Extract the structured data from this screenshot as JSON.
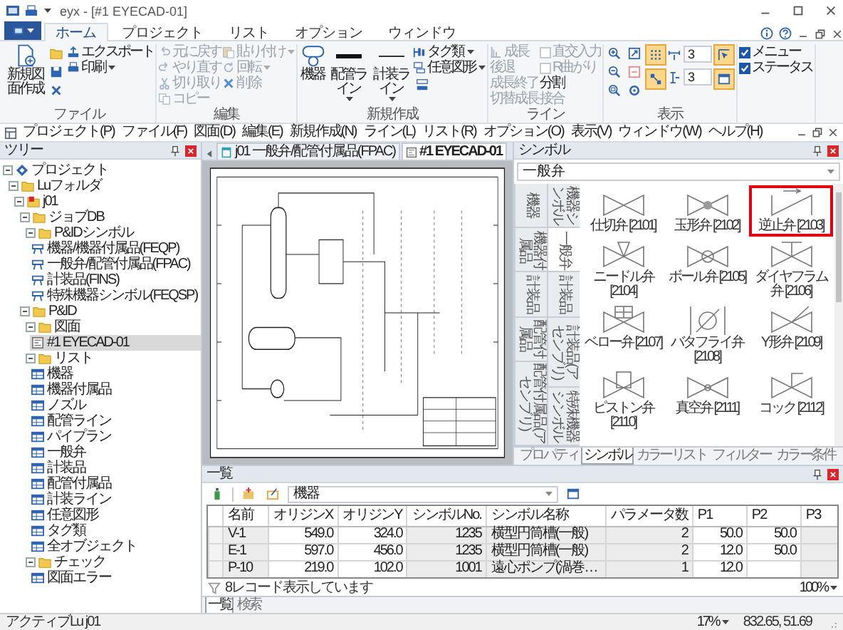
{
  "window": {
    "title": "eyx - [#1 EYECAD-01]"
  },
  "ribbon": {
    "tabs": [
      {
        "label": "ホーム",
        "selected": true
      },
      {
        "label": "プロジェクト",
        "selected": false
      },
      {
        "label": "リスト",
        "selected": false
      },
      {
        "label": "オプション",
        "selected": false
      },
      {
        "label": "ウィンドウ",
        "selected": false
      }
    ],
    "groups": [
      {
        "label": "ファイル",
        "columns": [
          [
            {
              "kind": "large",
              "label": "新規図面作成"
            }
          ],
          [
            {
              "kind": "icon"
            },
            {
              "kind": "icon"
            },
            {
              "kind": "icon"
            }
          ],
          [
            {
              "kind": "small",
              "label": "エクスポート"
            },
            {
              "kind": "small",
              "label": "印刷",
              "dropdown": true
            }
          ]
        ]
      },
      {
        "label": "編集",
        "columns": [
          [
            {
              "kind": "small",
              "label": "元に戻す",
              "disabled": true
            },
            {
              "kind": "small",
              "label": "やり直す",
              "disabled": true
            },
            {
              "kind": "small",
              "label": "切り取り",
              "disabled": true
            },
            {
              "kind": "small",
              "label": "コピー",
              "disabled": true
            }
          ],
          [
            {
              "kind": "small",
              "label": "貼り付け",
              "disabled": true,
              "dropdown": true
            },
            {
              "kind": "small",
              "label": "回転",
              "disabled": true,
              "dropdown": true
            },
            {
              "kind": "small",
              "label": "削除",
              "disabled": true
            }
          ]
        ]
      },
      {
        "label": "新規作成",
        "columns": [
          [
            {
              "kind": "large",
              "label": "機器"
            }
          ],
          [
            {
              "kind": "large",
              "label": "配管ライン",
              "dropdown": true
            }
          ],
          [
            {
              "kind": "large",
              "label": "計装ライン",
              "dropdown": true
            }
          ],
          [
            {
              "kind": "small",
              "label": "タグ類",
              "dropdown": true
            },
            {
              "kind": "small",
              "label": "任意図形",
              "dropdown": true
            },
            {
              "kind": "icon"
            }
          ]
        ]
      },
      {
        "label": "ライン",
        "columns": [
          [
            {
              "kind": "small",
              "label": "成長",
              "disabled": true
            },
            {
              "kind": "small",
              "label": "後退",
              "disabled": true
            },
            {
              "kind": "small",
              "label": "成長終了",
              "disabled": true
            },
            {
              "kind": "small",
              "label": "切替成長",
              "disabled": true
            }
          ],
          [
            {
              "kind": "check",
              "label": "直交入力",
              "disabled": true,
              "checked": false
            },
            {
              "kind": "check",
              "label": "R曲がり",
              "disabled": true,
              "checked": false
            },
            {
              "kind": "small",
              "label": "分割",
              "disabled": false
            },
            {
              "kind": "small",
              "label": "接合",
              "disabled": true
            }
          ]
        ]
      },
      {
        "label": "表示",
        "columns": [
          [
            {
              "kind": "icon"
            },
            {
              "kind": "icon"
            },
            {
              "kind": "icon"
            }
          ],
          [
            {
              "kind": "icon"
            },
            {
              "kind": "icon"
            },
            {
              "kind": "icon"
            }
          ],
          [
            {
              "kind": "toggle",
              "selected": true
            },
            {
              "kind": "toggle",
              "selected": true
            }
          ],
          [
            {
              "kind": "field",
              "value": "3"
            },
            {
              "kind": "field",
              "value": "3"
            }
          ],
          [
            {
              "kind": "toggle",
              "selected": true
            },
            {
              "kind": "toggle",
              "selected": true
            }
          ]
        ]
      },
      {
        "columns": [
          [
            {
              "kind": "check",
              "label": "メニュー",
              "checked": true
            },
            {
              "kind": "check",
              "label": "ステータス",
              "checked": true
            }
          ]
        ]
      }
    ]
  },
  "menu": [
    "プロジェクト(P)",
    "ファイル(F)",
    "図面(D)",
    "編集(E)",
    "新規作成(N)",
    "ライン(L)",
    "リスト(R)",
    "オプション(O)",
    "表示(V)",
    "ウィンドウ(W)",
    "ヘルプ(H)"
  ],
  "tree": {
    "title": "ツリー",
    "nodes": [
      {
        "label": "プロジェクト",
        "kind": "project",
        "expanded": true,
        "selected": false,
        "children": [
          {
            "label": "Luフォルダ",
            "kind": "folder",
            "expanded": true,
            "selected": false,
            "children": [
              {
                "label": "j01",
                "kind": "job",
                "expanded": true,
                "selected": false,
                "children": [
                  {
                    "label": "ジョブDB",
                    "kind": "folder",
                    "expanded": true,
                    "selected": false,
                    "children": [
                      {
                        "label": "P&IDシンボル",
                        "kind": "folder",
                        "expanded": true,
                        "selected": false,
                        "children": [
                          {
                            "label": "機器/機器付属品(FEQP)",
                            "kind": "symbolset",
                            "selected": false
                          },
                          {
                            "label": "一般弁/配管付属品(FPAC)",
                            "kind": "symbolset",
                            "selected": false
                          },
                          {
                            "label": "計装品(FINS)",
                            "kind": "symbolset",
                            "selected": false
                          },
                          {
                            "label": "特殊機器シンボル(FEQSP)",
                            "kind": "symbolset",
                            "selected": false
                          }
                        ]
                      }
                    ]
                  },
                  {
                    "label": "P&ID",
                    "kind": "folder",
                    "expanded": true,
                    "selected": false,
                    "children": [
                      {
                        "label": "図面",
                        "kind": "folder",
                        "expanded": true,
                        "selected": false,
                        "children": [
                          {
                            "label": "#1 EYECAD-01",
                            "kind": "drawing",
                            "selected": true
                          }
                        ]
                      },
                      {
                        "label": "リスト",
                        "kind": "folder",
                        "expanded": true,
                        "selected": false,
                        "children": [
                          {
                            "label": "機器",
                            "kind": "list",
                            "selected": false
                          },
                          {
                            "label": "機器付属品",
                            "kind": "list",
                            "selected": false
                          },
                          {
                            "label": "ノズル",
                            "kind": "list",
                            "selected": false
                          },
                          {
                            "label": "配管ライン",
                            "kind": "list",
                            "selected": false
                          },
                          {
                            "label": "パイプラン",
                            "kind": "list",
                            "selected": false
                          },
                          {
                            "label": "一般弁",
                            "kind": "list",
                            "selected": false
                          },
                          {
                            "label": "計装品",
                            "kind": "list",
                            "selected": false
                          },
                          {
                            "label": "配管付属品",
                            "kind": "list",
                            "selected": false
                          },
                          {
                            "label": "計装ライン",
                            "kind": "list",
                            "selected": false
                          },
                          {
                            "label": "任意図形",
                            "kind": "list",
                            "selected": false
                          },
                          {
                            "label": "タグ類",
                            "kind": "list",
                            "selected": false
                          },
                          {
                            "label": "全オブジェクト",
                            "kind": "list",
                            "selected": false
                          }
                        ]
                      },
                      {
                        "label": "チェック",
                        "kind": "folder",
                        "expanded": true,
                        "selected": false,
                        "children": [
                          {
                            "label": "図面エラー",
                            "kind": "list",
                            "selected": false
                          }
                        ]
                      }
                    ]
                  }
                ]
              }
            ]
          }
        ]
      }
    ]
  },
  "documents": {
    "tabs": [
      {
        "label": "j01 一般弁/配管付属品(FPAC)",
        "selected": false
      },
      {
        "label": "#1 EYECAD-01",
        "selected": true
      }
    ]
  },
  "symbols": {
    "title": "シンボル",
    "category": "一般弁",
    "side_tab_columns": [
      {
        "tabs": [
          {
            "label": "機器",
            "selected": false
          },
          {
            "label": "機器付属品",
            "selected": false
          },
          {
            "label": "計装品",
            "selected": false
          },
          {
            "label": "配管付属品",
            "selected": false
          },
          {
            "label": "配管付属品(アセンブリ)",
            "selected": false
          }
        ]
      },
      {
        "tabs": [
          {
            "label": "機器シンボル",
            "selected": false
          },
          {
            "label": "一般弁",
            "selected": true
          },
          {
            "label": "計装品",
            "selected": false
          },
          {
            "label": "計装品(アセンブリ)",
            "selected": false
          },
          {
            "label": "特殊機器シンボル",
            "selected": false
          }
        ]
      }
    ],
    "items": [
      {
        "label": "仕切弁 [2101]",
        "selected": false
      },
      {
        "label": "玉形弁 [2102]",
        "selected": false
      },
      {
        "label": "逆止弁 [2103]",
        "selected": true
      },
      {
        "label": "ニードル弁 [2104]",
        "selected": false
      },
      {
        "label": "ボール弁 [2105]",
        "selected": false
      },
      {
        "label": "ダイヤフラム弁 [2106]",
        "selected": false
      },
      {
        "label": "ベロー弁 [2107]",
        "selected": false
      },
      {
        "label": "バタフライ弁 [2108]",
        "selected": false
      },
      {
        "label": "Y形弁 [2109]",
        "selected": false
      },
      {
        "label": "ピストン弁 [2110]",
        "selected": false
      },
      {
        "label": "真空弁 [2111]",
        "selected": false
      },
      {
        "label": "コック [2112]",
        "selected": false
      }
    ],
    "tabs": [
      {
        "label": "プロパティ",
        "selected": false
      },
      {
        "label": "シンボル",
        "selected": true
      },
      {
        "label": "カラーリスト",
        "selected": false
      },
      {
        "label": "フィルター",
        "selected": false
      },
      {
        "label": "カラー条件",
        "selected": false
      }
    ]
  },
  "list": {
    "title": "一覧",
    "filter": "機器",
    "columns": [
      {
        "label": "名前",
        "editable": false
      },
      {
        "label": "オリジンX",
        "editable": true
      },
      {
        "label": "オリジンY",
        "editable": true
      },
      {
        "label": "シンボルNo.",
        "editable": false
      },
      {
        "label": "シンボル名称",
        "editable": false
      },
      {
        "label": "パラメータ数",
        "editable": false
      },
      {
        "label": "P1",
        "editable": true
      },
      {
        "label": "P2",
        "editable": true
      },
      {
        "label": "P3",
        "editable": false
      }
    ],
    "rows": [
      [
        "V-1",
        "549.0",
        "324.0",
        "1235",
        "横型円筒槽(一般)",
        "2",
        "50.0",
        "50.0",
        null
      ],
      [
        "E-1",
        "597.0",
        "456.0",
        "1235",
        "横型円筒槽(一般)",
        "2",
        "12.0",
        "50.0",
        null
      ],
      [
        "P-10",
        "219.0",
        "102.0",
        "1001",
        "遠心ポンプ(渦巻…",
        "1",
        "12.0",
        null,
        null
      ]
    ],
    "record_status": "8レコード表示しています",
    "zoom": "100%",
    "tabs": [
      {
        "label": "一覧",
        "selected": true
      },
      {
        "label": "検索",
        "selected": false
      }
    ]
  },
  "status_bar": {
    "left": "アクティブLu j01",
    "zoom": "17%",
    "coordinates": "832.65, 51.69"
  }
}
